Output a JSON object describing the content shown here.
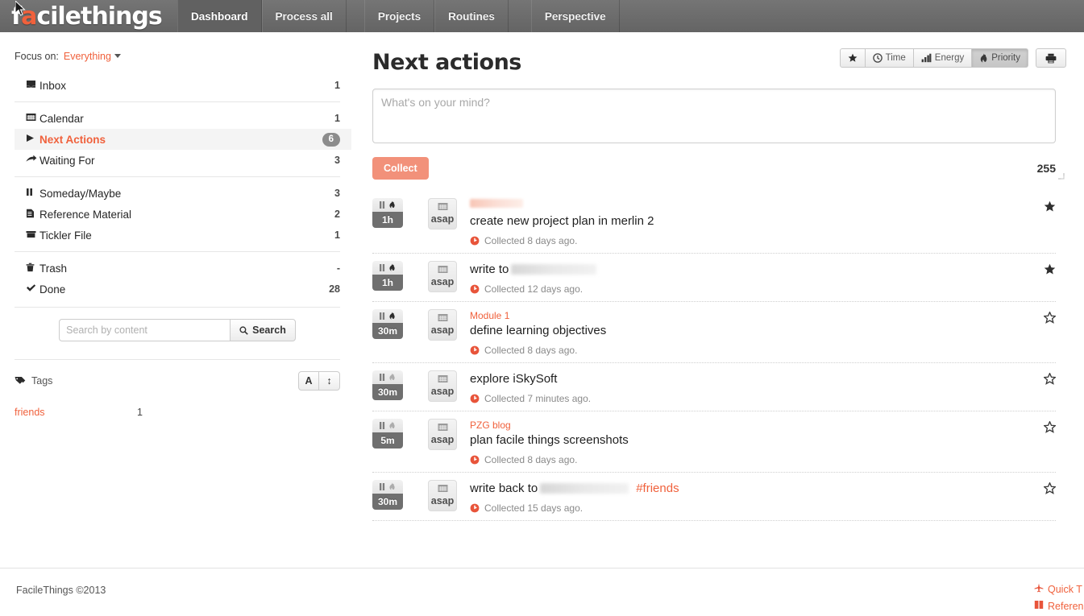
{
  "brand": {
    "prefix": "f",
    "accent": "a",
    "suffix": "cilethings",
    "full": "facilethings"
  },
  "nav": {
    "items": [
      {
        "label": "Dashboard",
        "active": true
      },
      {
        "label": "Process all",
        "active": false
      },
      {
        "label": "Projects",
        "active": false
      },
      {
        "label": "Routines",
        "active": false
      },
      {
        "label": "Perspective",
        "active": false
      }
    ]
  },
  "sidebar": {
    "focus": {
      "label": "Focus on:",
      "value": "Everything",
      "caret_icon": "chevron-down-icon"
    },
    "groups": [
      {
        "items": [
          {
            "label": "Inbox",
            "count": "1",
            "icon": "inbox-icon",
            "glyph": "✉",
            "active": false,
            "badge": false
          }
        ]
      },
      {
        "items": [
          {
            "label": "Calendar",
            "count": "1",
            "icon": "calendar-icon",
            "glyph": "☷",
            "active": false,
            "badge": false
          },
          {
            "label": "Next Actions",
            "count": "6",
            "icon": "play-triangle-icon",
            "glyph": "▶",
            "active": true,
            "badge": true
          },
          {
            "label": "Waiting For",
            "count": "3",
            "icon": "arrow-forward-icon",
            "glyph": "➦",
            "active": false,
            "badge": false
          }
        ]
      },
      {
        "items": [
          {
            "label": "Someday/Maybe",
            "count": "3",
            "icon": "pause-icon",
            "glyph": "‖",
            "active": false,
            "badge": false
          },
          {
            "label": "Reference Material",
            "count": "2",
            "icon": "document-icon",
            "glyph": "☰",
            "active": false,
            "badge": false
          },
          {
            "label": "Tickler File",
            "count": "1",
            "icon": "archive-box-icon",
            "glyph": "▬",
            "active": false,
            "badge": false
          }
        ]
      },
      {
        "items": [
          {
            "label": "Trash",
            "count": "-",
            "icon": "trash-icon",
            "glyph": "⍁",
            "active": false,
            "badge": false
          },
          {
            "label": "Done",
            "count": "28",
            "icon": "check-icon",
            "glyph": "✔",
            "active": false,
            "badge": false
          }
        ]
      }
    ],
    "search": {
      "placeholder": "Search by content",
      "value": "",
      "button_label": "Search",
      "button_icon": "magnifier-icon"
    },
    "tags": {
      "label": "Tags",
      "icon": "tag-icon",
      "sort_alpha_label": "A",
      "sort_size_label": "↕",
      "items": [
        {
          "name": "friends",
          "count": "1"
        }
      ]
    }
  },
  "main": {
    "title": "Next actions",
    "toolbar": {
      "buttons": [
        {
          "label": "",
          "icon": "star-icon",
          "active": false,
          "name": "filter-star"
        },
        {
          "label": "Time",
          "icon": "clock-icon",
          "active": false,
          "name": "filter-time"
        },
        {
          "label": "Energy",
          "icon": "energy-bars-icon",
          "active": false,
          "name": "filter-energy"
        },
        {
          "label": "Priority",
          "icon": "flame-icon",
          "active": true,
          "name": "filter-priority"
        }
      ],
      "print": {
        "label": "",
        "icon": "printer-icon"
      }
    },
    "collect": {
      "placeholder": "What's on your mind?",
      "value": "",
      "button_label": "Collect",
      "counter": "255",
      "button_color": "#f2917a"
    },
    "tasks": [
      {
        "time": "1h",
        "priority_icon": "flame-icon",
        "priority_high": true,
        "pause_icon": "pause-icon",
        "schedule_label": "asap",
        "schedule_icon": "calendar-icon",
        "project": "",
        "project_redacted": true,
        "title": "create new project plan in merlin 2",
        "title_redacted": false,
        "hashtag": "",
        "meta": "Collected 8 days ago.",
        "meta_icon": "clock-icon",
        "starred": true
      },
      {
        "time": "1h",
        "priority_icon": "flame-icon",
        "priority_high": true,
        "pause_icon": "pause-icon",
        "schedule_label": "asap",
        "schedule_icon": "calendar-icon",
        "project": "",
        "project_redacted": false,
        "title": "write to",
        "title_redacted": true,
        "hashtag": "",
        "meta": "Collected 12 days ago.",
        "meta_icon": "clock-icon",
        "starred": true
      },
      {
        "time": "30m",
        "priority_icon": "flame-icon",
        "priority_high": true,
        "pause_icon": "pause-icon",
        "schedule_label": "asap",
        "schedule_icon": "calendar-icon",
        "project": "Module 1",
        "project_redacted": false,
        "title": "define learning objectives",
        "title_redacted": false,
        "hashtag": "",
        "meta": "Collected 8 days ago.",
        "meta_icon": "clock-icon",
        "starred": false
      },
      {
        "time": "30m",
        "priority_icon": "flame-icon",
        "priority_high": false,
        "pause_icon": "pause-icon",
        "schedule_label": "asap",
        "schedule_icon": "calendar-icon",
        "project": "",
        "project_redacted": false,
        "title": "explore iSkySoft",
        "title_redacted": false,
        "hashtag": "",
        "meta": "Collected 7 minutes ago.",
        "meta_icon": "clock-icon",
        "starred": false
      },
      {
        "time": "5m",
        "priority_icon": "flame-icon",
        "priority_high": false,
        "pause_icon": "pause-icon",
        "schedule_label": "asap",
        "schedule_icon": "calendar-icon",
        "project": "PZG blog",
        "project_redacted": false,
        "title": "plan facile things screenshots",
        "title_redacted": false,
        "hashtag": "",
        "meta": "Collected 8 days ago.",
        "meta_icon": "clock-icon",
        "starred": false
      },
      {
        "time": "30m",
        "priority_icon": "flame-icon",
        "priority_high": false,
        "pause_icon": "pause-icon",
        "schedule_label": "asap",
        "schedule_icon": "calendar-icon",
        "project": "",
        "project_redacted": false,
        "title": "write back to",
        "title_redacted": true,
        "hashtag": "#friends",
        "meta": "Collected 15 days ago.",
        "meta_icon": "clock-icon",
        "starred": false
      }
    ]
  },
  "footer": {
    "copyright": "FacileThings ©2013",
    "links": [
      {
        "label": "Quick T",
        "icon": "plane-icon"
      },
      {
        "label": "Referen",
        "icon": "book-icon"
      }
    ]
  },
  "colors": {
    "accent": "#f0613c",
    "nav_bg": "#6d6d6d",
    "badge_bg": "#8c8c8c",
    "collect_btn": "#f2917a"
  }
}
